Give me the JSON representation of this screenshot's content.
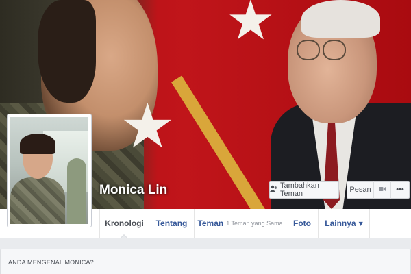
{
  "profile": {
    "name": "Monica Lin"
  },
  "actions": {
    "add_friend_icon": "person-plus-icon",
    "add_friend_label": "Tambahkan Teman",
    "message_label": "Pesan",
    "video_icon": "video-camera-icon",
    "more_label": "•••"
  },
  "nav": {
    "tabs": [
      {
        "label": "Kronologi",
        "active": true
      },
      {
        "label": "Tentang"
      },
      {
        "label": "Teman",
        "sub": "1 Teman yang Sama"
      },
      {
        "label": "Foto"
      },
      {
        "label": "Lainnya",
        "icon": "caret-down-icon"
      }
    ]
  },
  "know_panel": {
    "title": "ANDA MENGENAL MONICA?"
  },
  "colors": {
    "link_blue": "#365899",
    "cover_red": "#b10d12",
    "page_bg": "#e9ebee"
  }
}
